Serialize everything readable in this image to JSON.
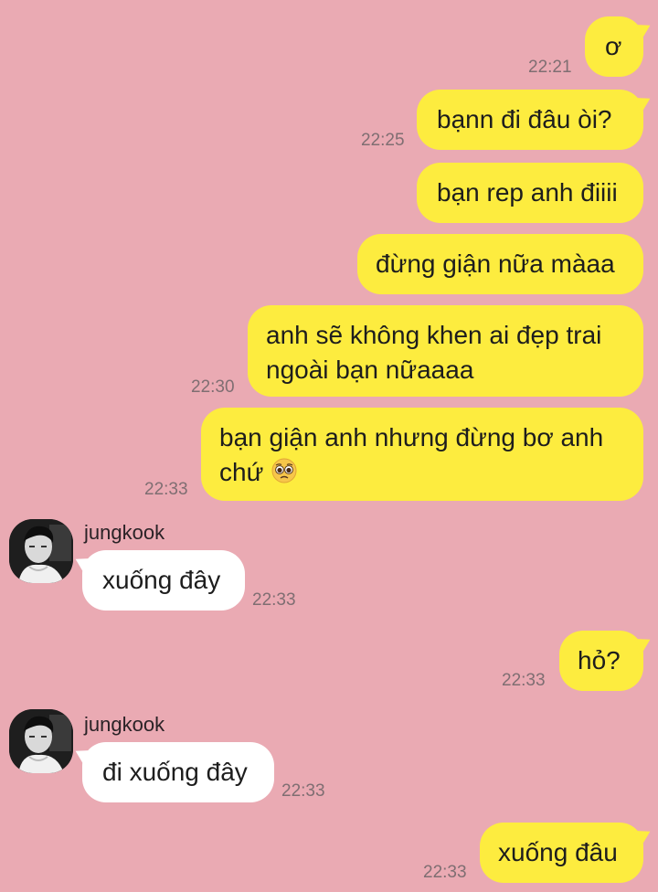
{
  "messages": [
    {
      "text": "ơ",
      "time": "22:21"
    },
    {
      "text": "bạnn đi đâu òi?",
      "time": "22:25"
    },
    {
      "text": "bạn rep anh điiii"
    },
    {
      "text": "đừng giận nữa màaa"
    },
    {
      "text": "anh sẽ không khen ai đẹp trai ngoài bạn nữaaaa",
      "time": "22:30"
    },
    {
      "text": "bạn giận anh nhưng đừng bơ anh chứ",
      "emoji": "pleading-face-emoji",
      "time": "22:33"
    },
    {
      "sender": "jungkook",
      "text": "xuống đây",
      "time": "22:33"
    },
    {
      "text": "hỏ?",
      "time": "22:33"
    },
    {
      "sender": "jungkook",
      "text": "đi xuống đây",
      "time": "22:33"
    },
    {
      "text": "xuống đâu",
      "time": "22:33"
    }
  ],
  "colors": {
    "background": "#eaaab3",
    "outgoing_bubble": "#fdec3f",
    "incoming_bubble": "#ffffff",
    "timestamp": "#7f6e72"
  }
}
